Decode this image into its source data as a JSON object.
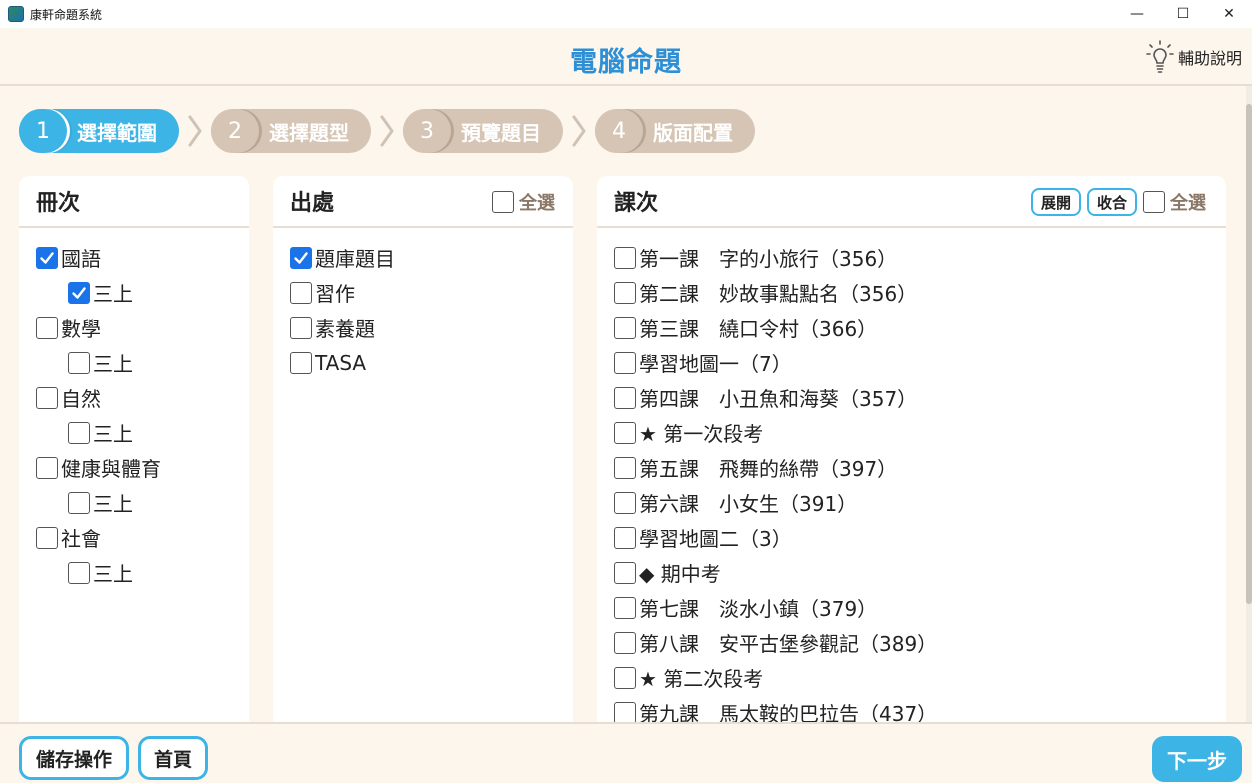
{
  "window": {
    "title": "康軒命題系統",
    "minimize": "—",
    "maximize": "☐",
    "close": "✕"
  },
  "header": {
    "title": "電腦命題",
    "help_label": "輔助說明",
    "help_icon": "lightbulb-icon"
  },
  "steps": [
    {
      "num": "1",
      "label": "選擇範圍",
      "active": true
    },
    {
      "num": "2",
      "label": "選擇題型",
      "active": false
    },
    {
      "num": "3",
      "label": "預覽題目",
      "active": false
    },
    {
      "num": "4",
      "label": "版面配置",
      "active": false
    }
  ],
  "volumes": {
    "title": "冊次",
    "items": [
      {
        "label": "國語",
        "checked": true,
        "indent": false
      },
      {
        "label": "三上",
        "checked": true,
        "indent": true
      },
      {
        "label": "數學",
        "checked": false,
        "indent": false
      },
      {
        "label": "三上",
        "checked": false,
        "indent": true
      },
      {
        "label": "自然",
        "checked": false,
        "indent": false
      },
      {
        "label": "三上",
        "checked": false,
        "indent": true
      },
      {
        "label": "健康與體育",
        "checked": false,
        "indent": false
      },
      {
        "label": "三上",
        "checked": false,
        "indent": true
      },
      {
        "label": "社會",
        "checked": false,
        "indent": false
      },
      {
        "label": "三上",
        "checked": false,
        "indent": true
      }
    ]
  },
  "sources": {
    "title": "出處",
    "select_all": "全選",
    "items": [
      {
        "label": "題庫題目",
        "checked": true
      },
      {
        "label": "習作",
        "checked": false
      },
      {
        "label": "素養題",
        "checked": false
      },
      {
        "label": "TASA",
        "checked": false
      }
    ]
  },
  "lessons": {
    "title": "課次",
    "expand": "展開",
    "collapse": "收合",
    "select_all": "全選",
    "items": [
      {
        "label": "第一課　字的小旅行（356）"
      },
      {
        "label": "第二課　妙故事點點名（356）"
      },
      {
        "label": "第三課　繞口令村（366）"
      },
      {
        "label": "學習地圖一（7）"
      },
      {
        "label": "第四課　小丑魚和海葵（357）"
      },
      {
        "label": "★ 第一次段考"
      },
      {
        "label": "第五課　飛舞的絲帶（397）"
      },
      {
        "label": "第六課　小女生（391）"
      },
      {
        "label": "學習地圖二（3）"
      },
      {
        "label": "◆ 期中考"
      },
      {
        "label": "第七課　淡水小鎮（379）"
      },
      {
        "label": "第八課　安平古堡參觀記（389）"
      },
      {
        "label": "★ 第二次段考"
      },
      {
        "label": "第九課　馬太鞍的巴拉告（437）"
      }
    ]
  },
  "footer": {
    "save_label": "儲存操作",
    "home_label": "首頁",
    "next_label": "下一步"
  },
  "colors": {
    "accent": "#3db4e6",
    "title_blue": "#2d8fd5",
    "step_inactive": "#d6c5b4",
    "background": "#fdf6ec",
    "checkbox_checked": "#1a73e8"
  }
}
